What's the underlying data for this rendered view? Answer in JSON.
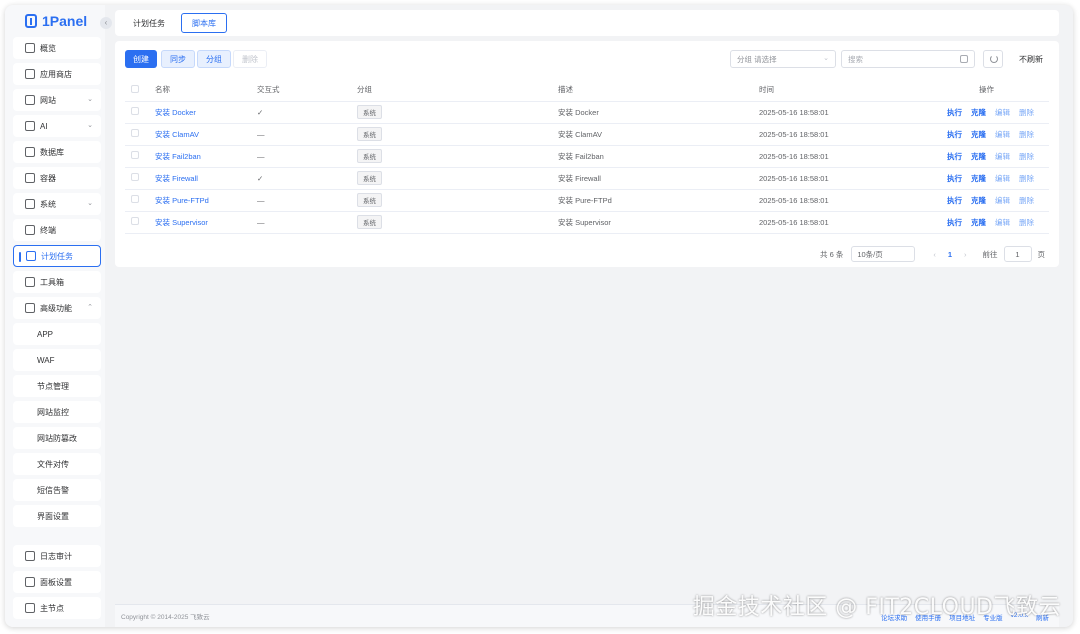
{
  "app": {
    "logo_text": "1Panel"
  },
  "sidebar": {
    "items": [
      {
        "label": "概览",
        "icon": "home-icon"
      },
      {
        "label": "应用商店",
        "icon": "grid-icon"
      },
      {
        "label": "网站",
        "icon": "globe-icon",
        "expandable": true
      },
      {
        "label": "AI",
        "icon": "robot-icon",
        "expandable": true
      },
      {
        "label": "数据库",
        "icon": "database-icon"
      },
      {
        "label": "容器",
        "icon": "container-icon"
      },
      {
        "label": "系统",
        "icon": "system-icon",
        "expandable": true
      },
      {
        "label": "终端",
        "icon": "terminal-icon"
      },
      {
        "label": "计划任务",
        "icon": "calendar-icon",
        "active": true
      },
      {
        "label": "工具箱",
        "icon": "toolbox-icon"
      },
      {
        "label": "高级功能",
        "icon": "diamond-icon",
        "expanded": true
      }
    ],
    "subitems": [
      "APP",
      "WAF",
      "节点管理",
      "网站监控",
      "网站防篡改",
      "文件对传",
      "短信告警",
      "界面设置"
    ],
    "bottom_items": [
      {
        "label": "日志审计",
        "icon": "log-icon"
      },
      {
        "label": "面板设置",
        "icon": "settings-icon"
      },
      {
        "label": "主节点",
        "icon": "user-icon"
      }
    ]
  },
  "tabs": [
    {
      "label": "计划任务",
      "active": false
    },
    {
      "label": "脚本库",
      "active": true
    }
  ],
  "toolbar": {
    "create": "创建",
    "sync": "同步",
    "group": "分组",
    "delete": "删除",
    "group_filter_label": "分组",
    "group_filter_placeholder": "请选择",
    "search_placeholder": "搜索",
    "no_refresh": "不刷新"
  },
  "table": {
    "headers": [
      "名称",
      "交互式",
      "分组",
      "描述",
      "时间",
      "操作"
    ],
    "rows": [
      {
        "name": "安装 Docker",
        "interactive": "✓",
        "group": "系统",
        "desc": "安装 Docker",
        "time": "2025-05-16 18:58:01"
      },
      {
        "name": "安装 ClamAV",
        "interactive": "—",
        "group": "系统",
        "desc": "安装 ClamAV",
        "time": "2025-05-16 18:58:01"
      },
      {
        "name": "安装 Fail2ban",
        "interactive": "—",
        "group": "系统",
        "desc": "安装 Fail2ban",
        "time": "2025-05-16 18:58:01"
      },
      {
        "name": "安装 Firewall",
        "interactive": "✓",
        "group": "系统",
        "desc": "安装 Firewall",
        "time": "2025-05-16 18:58:01"
      },
      {
        "name": "安装 Pure-FTPd",
        "interactive": "—",
        "group": "系统",
        "desc": "安装 Pure-FTPd",
        "time": "2025-05-16 18:58:01"
      },
      {
        "name": "安装 Supervisor",
        "interactive": "—",
        "group": "系统",
        "desc": "安装 Supervisor",
        "time": "2025-05-16 18:58:01"
      }
    ],
    "actions": [
      "执行",
      "克隆",
      "编辑",
      "删除"
    ]
  },
  "pagination": {
    "total": "共 6 条",
    "page_size": "10条/页",
    "current_page": "1",
    "goto_label": "前往",
    "goto_value": "1",
    "page_suffix": "页"
  },
  "footer": {
    "copyright": "Copyright © 2014-2025 飞致云",
    "links": [
      "论坛求助",
      "使用手册",
      "项目地址",
      "专业版",
      "v2.0.x",
      "刷新"
    ]
  },
  "watermark": "掘金技术社区 @ FIT2CLOUD飞致云",
  "colors": {
    "accent": "#2b6ff1",
    "background": "#f2f3f5"
  }
}
